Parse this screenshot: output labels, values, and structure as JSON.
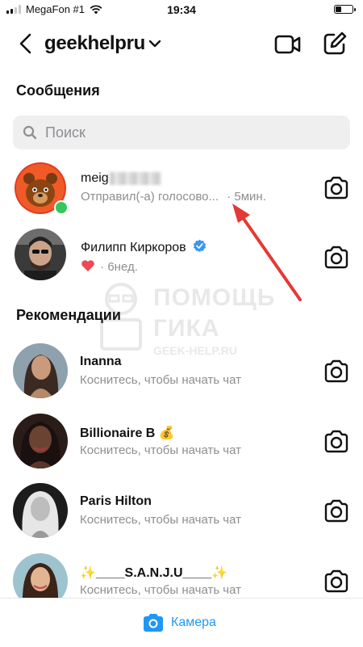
{
  "status": {
    "carrier": "MegaFon #1",
    "time": "19:34",
    "battery_level": 0.35
  },
  "header": {
    "username": "geekhelpru"
  },
  "messages_section": {
    "title": "Сообщения"
  },
  "search": {
    "placeholder": "Поиск"
  },
  "threads": [
    {
      "name": "meig",
      "status": "Отправил(-а) голосово...",
      "time": "· 5мин.",
      "online": true
    },
    {
      "name": "Филипп Киркоров",
      "verified": true,
      "reaction": "heart",
      "time": "· 6нед."
    }
  ],
  "recommendations_section": {
    "title": "Рекомендации"
  },
  "recommendations": [
    {
      "name": "Inanna",
      "subtitle": "Коснитесь, чтобы начать чат"
    },
    {
      "name": "Billionaire B 💰",
      "subtitle": "Коснитесь, чтобы начать чат"
    },
    {
      "name": "Paris Hilton",
      "subtitle": "Коснитесь, чтобы начать чат"
    },
    {
      "name": "✨____S.A.N.J.U____✨",
      "subtitle": "Коснитесь, чтобы начать чат"
    }
  ],
  "watermark": {
    "line1": "ПОМОЩЬ",
    "line2": "ГИКА",
    "line3": "GEEK-HELP.RU"
  },
  "bottom_bar": {
    "camera_label": "Камера"
  },
  "colors": {
    "accent": "#1f98f5",
    "annotation_arrow": "#e53935",
    "online": "#34c759",
    "verified": "#3897f0",
    "reaction": "#ed4956"
  }
}
